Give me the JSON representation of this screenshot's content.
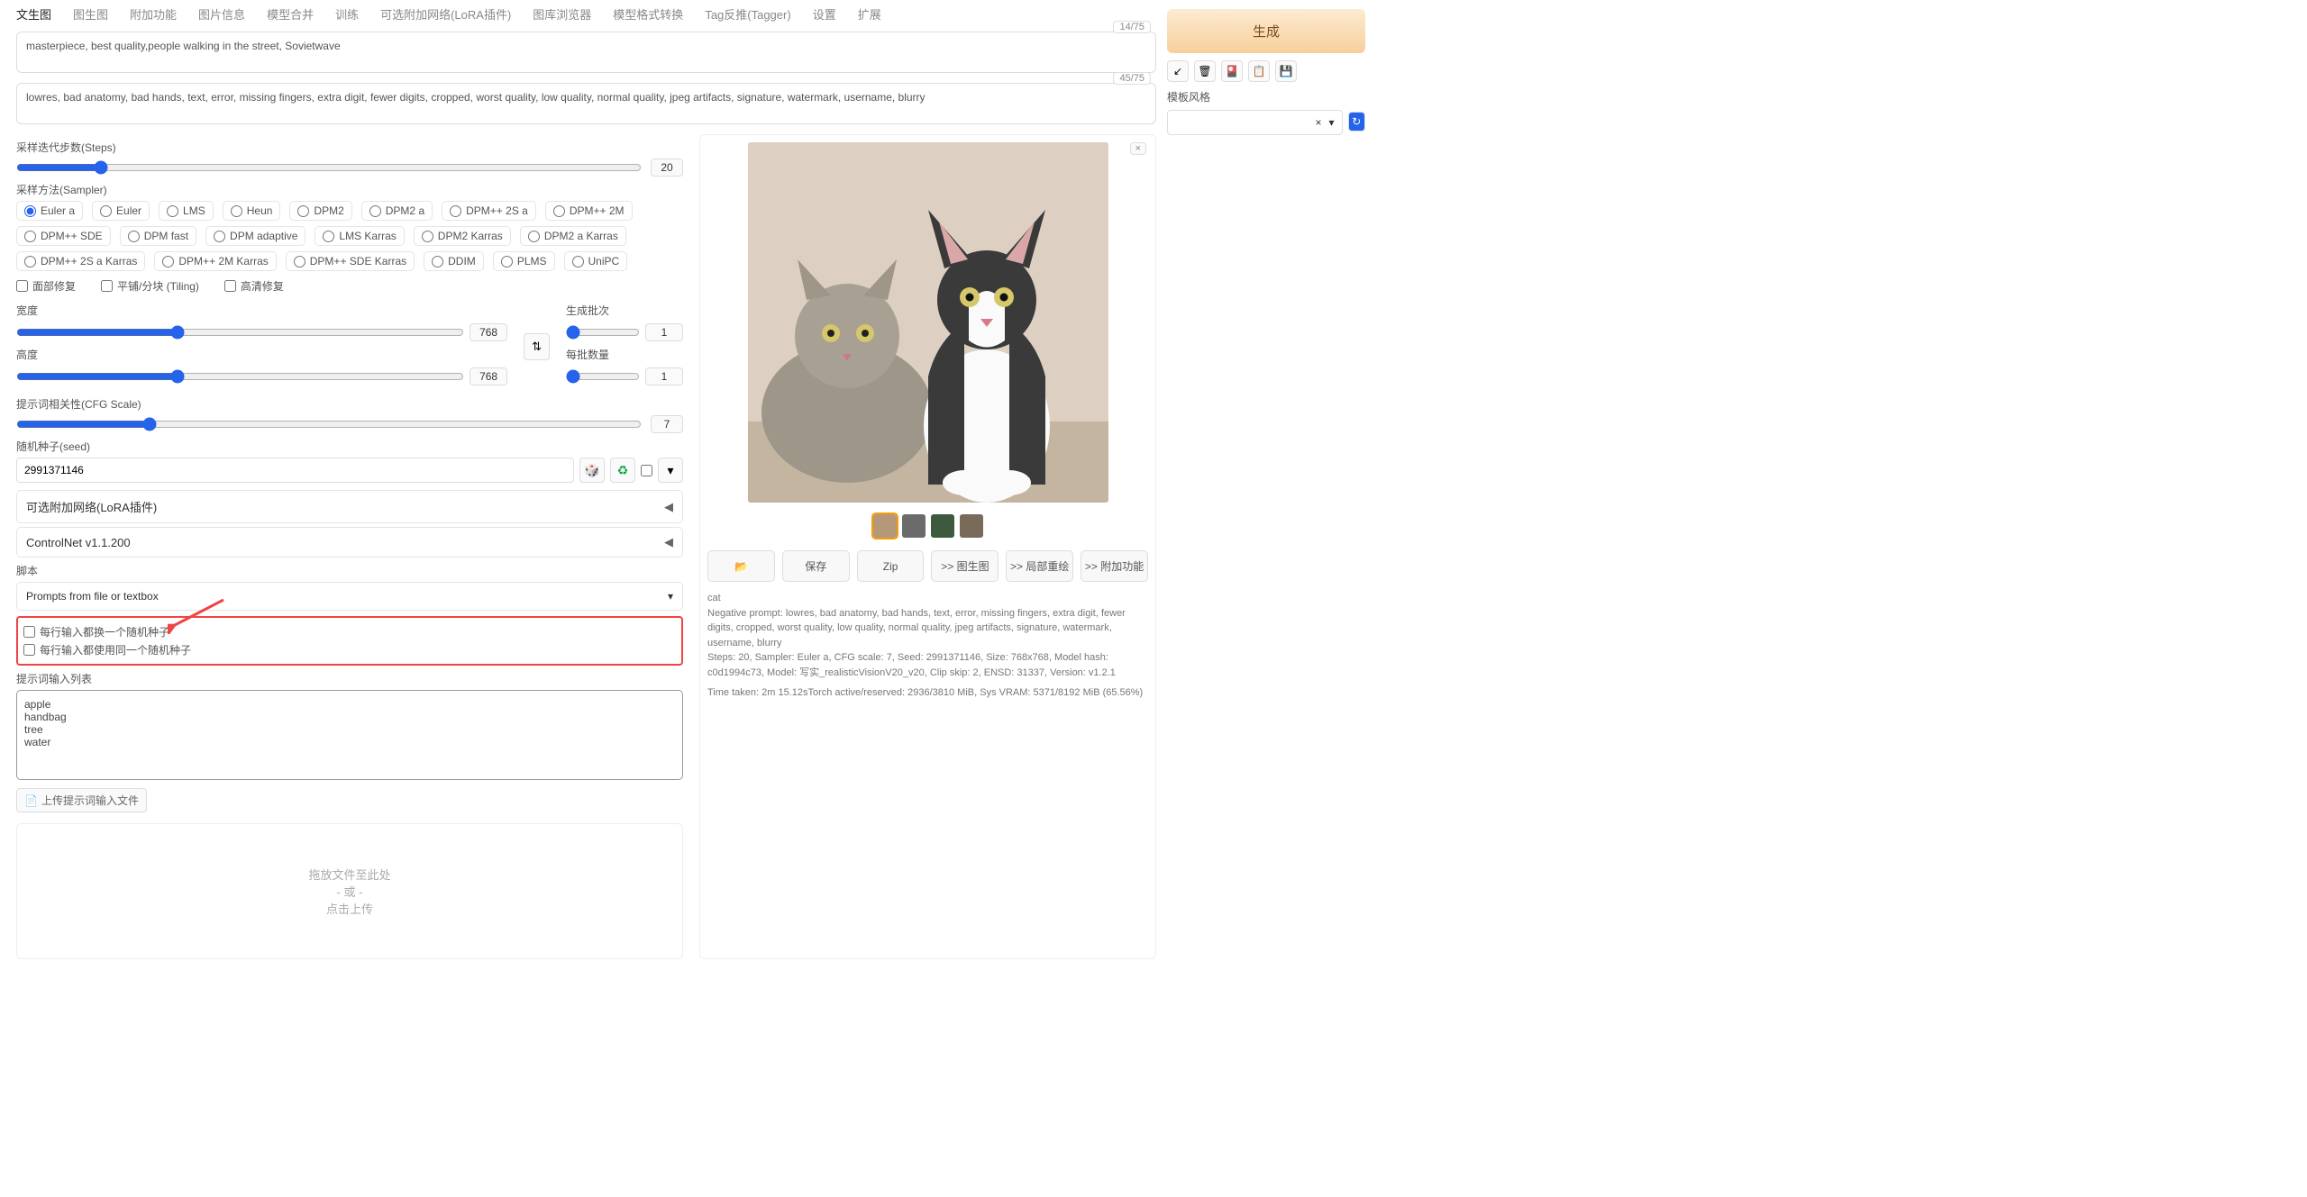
{
  "tabs": [
    "文生图",
    "图生图",
    "附加功能",
    "图片信息",
    "模型合并",
    "训练",
    "可选附加网络(LoRA插件)",
    "图库浏览器",
    "模型格式转换",
    "Tag反推(Tagger)",
    "设置",
    "扩展"
  ],
  "active_tab": 0,
  "prompt": {
    "text": "masterpiece, best quality,people walking in the street, Sovietwave",
    "count": "14/75"
  },
  "neg_prompt": {
    "text": "lowres, bad anatomy, bad hands, text, error, missing fingers, extra digit, fewer digits, cropped, worst quality, low quality, normal quality, jpeg artifacts, signature, watermark, username, blurry",
    "count": "45/75"
  },
  "steps": {
    "label": "采样迭代步数(Steps)",
    "value": "20"
  },
  "sampler_label": "采样方法(Sampler)",
  "samplers": [
    "Euler a",
    "Euler",
    "LMS",
    "Heun",
    "DPM2",
    "DPM2 a",
    "DPM++ 2S a",
    "DPM++ 2M",
    "DPM++ SDE",
    "DPM fast",
    "DPM adaptive",
    "LMS Karras",
    "DPM2 Karras",
    "DPM2 a Karras",
    "DPM++ 2S a Karras",
    "DPM++ 2M Karras",
    "DPM++ SDE Karras",
    "DDIM",
    "PLMS",
    "UniPC"
  ],
  "sampler_selected": "Euler a",
  "checks": {
    "face": "面部修复",
    "tile": "平铺/分块 (Tiling)",
    "hires": "高清修复"
  },
  "dims": {
    "width_lbl": "宽度",
    "width": "768",
    "height_lbl": "高度",
    "height": "768"
  },
  "batch": {
    "count_lbl": "生成批次",
    "count": "1",
    "size_lbl": "每批数量",
    "size": "1"
  },
  "cfg": {
    "label": "提示词相关性(CFG Scale)",
    "value": "7"
  },
  "seed": {
    "label": "随机种子(seed)",
    "value": "2991371146"
  },
  "accordions": {
    "lora": "可选附加网络(LoRA插件)",
    "controlnet": "ControlNet v1.1.200"
  },
  "script": {
    "label": "脚本",
    "selected": "Prompts from file or textbox"
  },
  "script_checks": {
    "a": "每行输入都换一个随机种子",
    "b": "每行输入都使用同一个随机种子"
  },
  "promptlist": {
    "label": "提示词输入列表",
    "text": "apple\nhandbag\ntree\nwater"
  },
  "upload_btn": "上传提示词输入文件",
  "dropzone": {
    "l1": "拖放文件至此处",
    "l2": "- 或 -",
    "l3": "点击上传"
  },
  "generate": "生成",
  "style_label": "模板风格",
  "actions": {
    "folder": "📂",
    "save": "保存",
    "zip": "Zip",
    "i2i": ">> 图生图",
    "inpaint": ">> 局部重绘",
    "extras": ">> 附加功能"
  },
  "info": {
    "l1": "cat",
    "l2": "Negative prompt: lowres, bad anatomy, bad hands, text, error, missing fingers, extra digit, fewer digits, cropped, worst quality, low quality, normal quality, jpeg artifacts, signature, watermark, username, blurry",
    "l3": "Steps: 20, Sampler: Euler a, CFG scale: 7, Seed: 2991371146, Size: 768x768, Model hash: c0d1994c73, Model: 写实_realisticVisionV20_v20, Clip skip: 2, ENSD: 31337, Version: v1.2.1",
    "l4": "Time taken: 2m 15.12sTorch active/reserved: 2936/3810 MiB, Sys VRAM: 5371/8192 MiB (65.56%)"
  }
}
